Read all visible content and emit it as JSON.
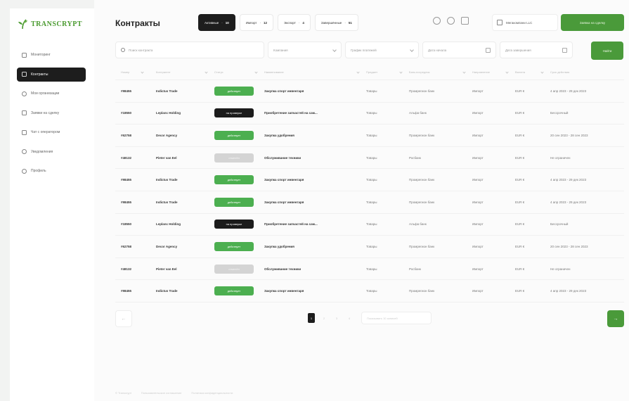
{
  "brand": {
    "name": "TRANSCRYPT",
    "accent": "#4a9a3a"
  },
  "sidebar": {
    "items": [
      {
        "label": "Мониторинг",
        "icon": "monitor-icon",
        "active": false
      },
      {
        "label": "Контракты",
        "icon": "document-icon",
        "active": true
      },
      {
        "label": "Мои организации",
        "icon": "building-icon",
        "active": false
      },
      {
        "label": "Заявки на сделку",
        "icon": "request-icon",
        "active": false
      },
      {
        "label": "Чат с оператором",
        "icon": "chat-icon",
        "active": false
      },
      {
        "label": "Уведомления",
        "icon": "bell-icon",
        "active": false
      },
      {
        "label": "Профиль",
        "icon": "user-icon",
        "active": false
      }
    ]
  },
  "header": {
    "title": "Контракты",
    "tabs": [
      {
        "label": "Активные",
        "count": "10",
        "active": true
      },
      {
        "label": "Импорт",
        "count": "12",
        "active": false
      },
      {
        "label": "Экспорт",
        "count": "4",
        "active": false
      },
      {
        "label": "Завершённые",
        "count": "51",
        "active": false
      }
    ],
    "company": "Мегакомпани LLC",
    "primary_button": "Заявка на сделку"
  },
  "filters": {
    "search_placeholder": "Поиск контракта",
    "company": "Компания",
    "currency_schedule": "График платежей",
    "date_start": "Дата начала",
    "date_end": "Дата завершения",
    "find_button": "Найти"
  },
  "table": {
    "columns": [
      "Номер",
      "Контрагент",
      "Статус",
      "Наименование",
      "Предмет",
      "Банк-посредник",
      "Направление",
      "Валюта",
      "Срок действия"
    ],
    "rows": [
      {
        "id": "#98455",
        "client": "Indictus Trade",
        "status": "действует",
        "status_color": "green",
        "subject": "Закупка спорт инвентаря",
        "type": "Товары",
        "bank": "Промрегион банк",
        "direction": "Импорт",
        "currency": "EUR €",
        "period": "4 апр 2023 - 29 дек 2023"
      },
      {
        "id": "#18550",
        "client": "Leplanc Holding",
        "status": "на проверке",
        "status_color": "black",
        "subject": "Приобретение запчастей на сам...",
        "type": "Товары",
        "bank": "Альфа банк",
        "direction": "Импорт",
        "currency": "EUR €",
        "period": "Бессрочный"
      },
      {
        "id": "#62758",
        "client": "Decor Agency",
        "status": "действует",
        "status_color": "green",
        "subject": "Закупка удобрения",
        "type": "Товары",
        "bank": "Промрегион банк",
        "direction": "Импорт",
        "currency": "EUR €",
        "period": "20 сен 2023 - 28 сен 2023"
      },
      {
        "id": "#48132",
        "client": "Pieter van Eel",
        "status": "отменён",
        "status_color": "gray",
        "subject": "Обслуживание техники",
        "type": "Товары",
        "bank": "Росбанк",
        "direction": "Импорт",
        "currency": "EUR €",
        "period": "Не ограничен"
      },
      {
        "id": "#98455",
        "client": "Indictus Trade",
        "status": "действует",
        "status_color": "green",
        "subject": "Закупка спорт инвентаря",
        "type": "Товары",
        "bank": "Промрегион банк",
        "direction": "Импорт",
        "currency": "EUR €",
        "period": "4 апр 2023 - 29 дек 2023"
      },
      {
        "id": "#98455",
        "client": "Indictus Trade",
        "status": "действует",
        "status_color": "green",
        "subject": "Закупка спорт инвентаря",
        "type": "Товары",
        "bank": "Промрегион банк",
        "direction": "Импорт",
        "currency": "EUR €",
        "period": "4 апр 2023 - 29 дек 2023"
      },
      {
        "id": "#18550",
        "client": "Leplanc Holding",
        "status": "на проверке",
        "status_color": "black",
        "subject": "Приобретение запчастей на сам...",
        "type": "Товары",
        "bank": "Альфа банк",
        "direction": "Импорт",
        "currency": "EUR €",
        "period": "Бессрочный"
      },
      {
        "id": "#62758",
        "client": "Decor Agency",
        "status": "действует",
        "status_color": "green",
        "subject": "Закупка удобрения",
        "type": "Товары",
        "bank": "Промрегион банк",
        "direction": "Импорт",
        "currency": "EUR €",
        "period": "20 сен 2023 - 28 сен 2023"
      },
      {
        "id": "#48132",
        "client": "Pieter van Eel",
        "status": "отменён",
        "status_color": "gray",
        "subject": "Обслуживание техники",
        "type": "Товары",
        "bank": "Росбанк",
        "direction": "Импорт",
        "currency": "EUR €",
        "period": "Не ограничен"
      },
      {
        "id": "#98455",
        "client": "Indictus Trade",
        "status": "действует",
        "status_color": "green",
        "subject": "Закупка спорт инвентаря",
        "type": "Товары",
        "bank": "Промрегион банк",
        "direction": "Импорт",
        "currency": "EUR €",
        "period": "4 апр 2023 - 29 дек 2023"
      }
    ]
  },
  "pagination": {
    "prev": "←",
    "next": "→",
    "pages": [
      "1",
      "2",
      "3",
      "4"
    ],
    "current": "1",
    "per_page": "Показывать 10 записей"
  },
  "footer": {
    "links": [
      "© Transcrypt",
      "Пользовательское соглашение",
      "Политика конфиденциальности"
    ]
  }
}
